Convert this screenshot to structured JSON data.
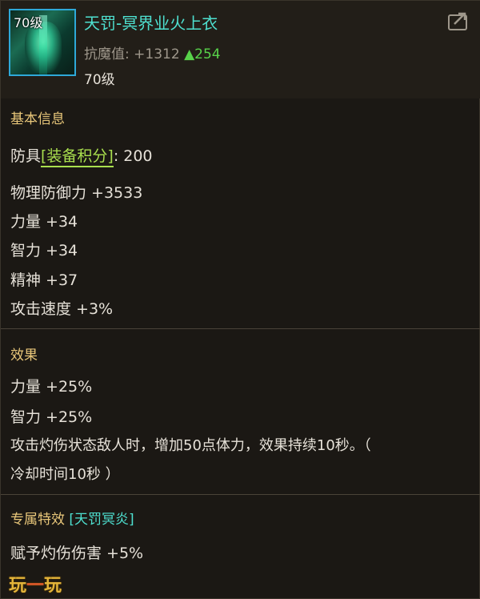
{
  "item": {
    "icon_level": "70级",
    "name": "天罚-冥界业火上衣",
    "stat_label": "抗魔值:",
    "stat_value": "+1312",
    "stat_gain_arrow": "▲",
    "stat_gain": "254",
    "level": "70级"
  },
  "basic": {
    "title": "基本信息",
    "armor_prefix": "防具",
    "score_label": "[装备积分]",
    "score_sep": ":",
    "score_value": "200",
    "stats": [
      "物理防御力 +3533",
      "力量 +34",
      "智力 +34",
      "精神 +37",
      "攻击速度 +3%"
    ]
  },
  "effect": {
    "title": "效果",
    "lines": [
      "力量 +25%",
      "智力 +25%",
      "攻击灼伤状态敌人时，增加50点体力，效果持续10秒。（",
      "冷却时间10秒 ）"
    ]
  },
  "exclusive": {
    "title": "专属特效",
    "set_name": "[天罚冥炎]",
    "lines": [
      "赋予灼伤伤害 +5%"
    ]
  },
  "watermark": {
    "left": "玩",
    "dash": "一",
    "right": "玩"
  },
  "colors": {
    "item_name": "#4ee0d0",
    "section_title": "#e9c77a",
    "gain": "#58d24a",
    "score_bracket": "#a9df4e"
  },
  "icons": {
    "share": "share-icon"
  }
}
